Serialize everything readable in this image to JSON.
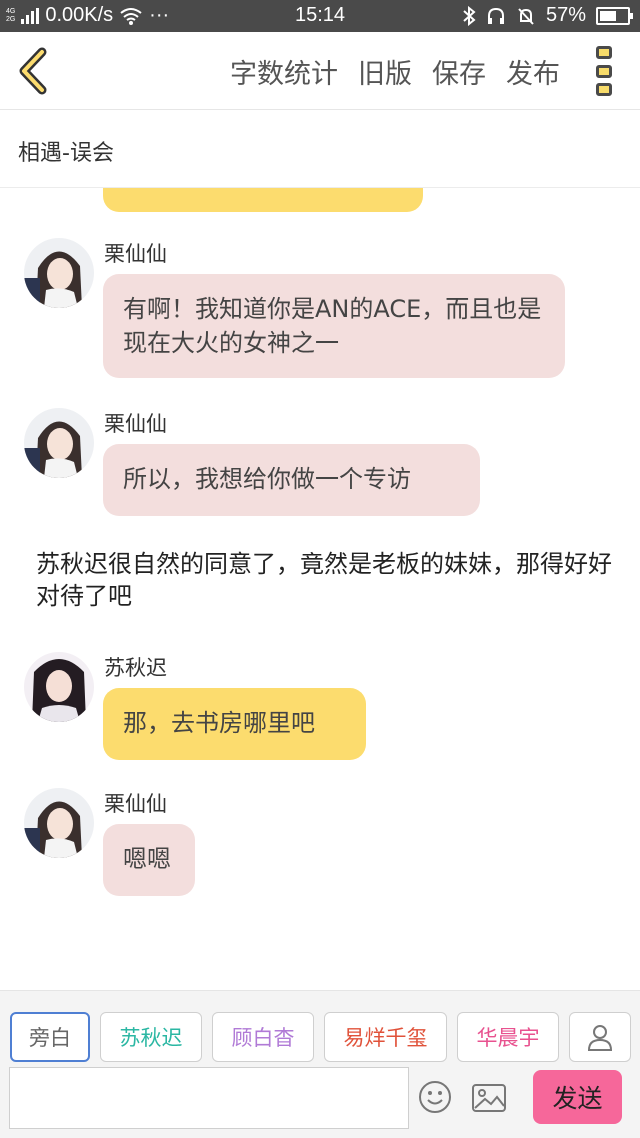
{
  "status_bar": {
    "network_top": "4G",
    "network_bottom": "2G",
    "speed": "0.00K/s",
    "dots": "···",
    "time": "15:14",
    "battery": "57%"
  },
  "toolbar": {
    "word_count": "字数统计",
    "old_version": "旧版",
    "save": "保存",
    "publish": "发布"
  },
  "chapter": {
    "title": "相遇-误会"
  },
  "messages": [
    {
      "sender": "栗仙仙",
      "text": "有啊！我知道你是AN的ACE，而且也是现在大火的女神之一"
    },
    {
      "sender": "栗仙仙",
      "text": "所以，我想给你做一个专访"
    },
    {
      "narration": "苏秋迟很自然的同意了，竟然是老板的妹妹，那得好好对待了吧"
    },
    {
      "sender": "苏秋迟",
      "text": "那，去书房哪里吧"
    },
    {
      "sender": "栗仙仙",
      "text": "嗯嗯"
    }
  ],
  "roles": [
    {
      "label": "旁白",
      "color": "#666666"
    },
    {
      "label": "苏秋迟",
      "color": "#2bb7a3"
    },
    {
      "label": "顾白杳",
      "color": "#b07ad6"
    },
    {
      "label": "易烊千玺",
      "color": "#e0523a"
    },
    {
      "label": "华晨宇",
      "color": "#e8528f"
    }
  ],
  "composer": {
    "send_label": "发送"
  },
  "colors": {
    "accent_yellow": "#fcdc6e",
    "bubble_pink": "#f3dedd",
    "send_pink": "#f6679a"
  }
}
